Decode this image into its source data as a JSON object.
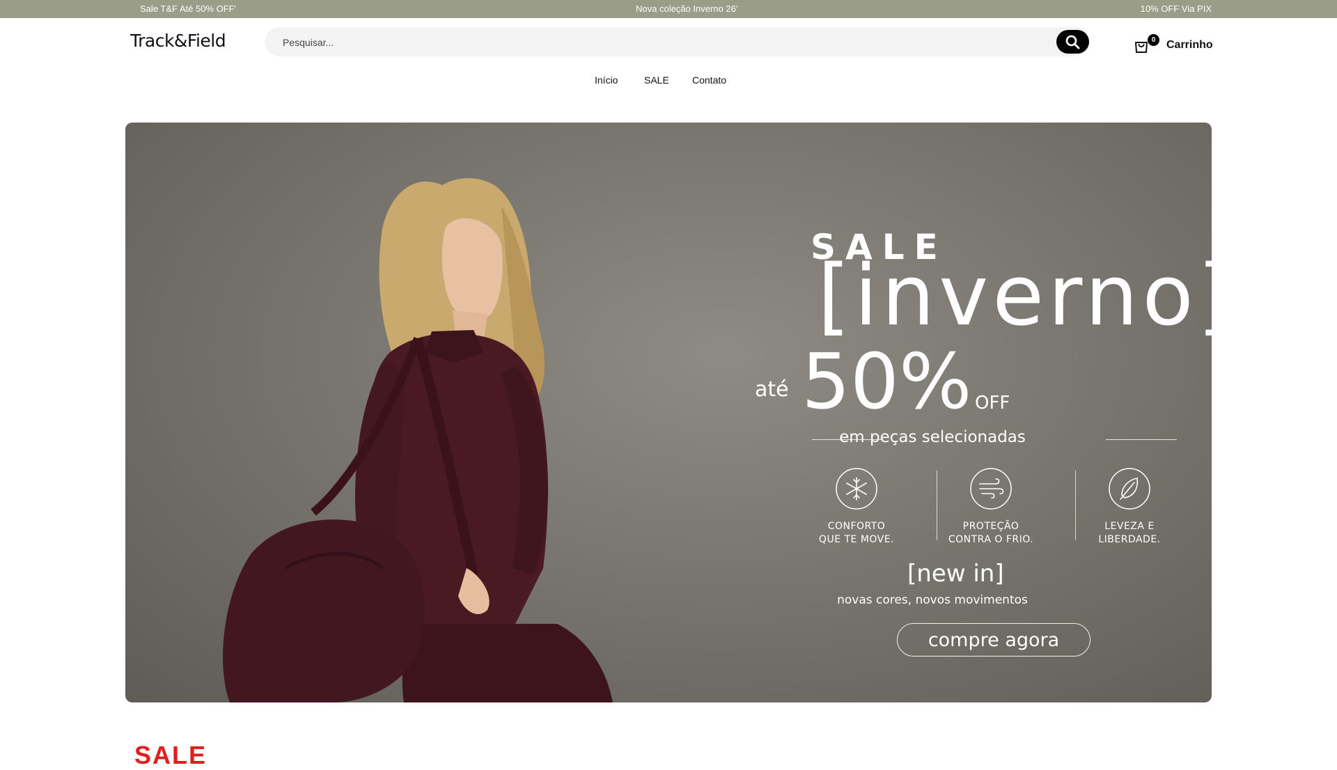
{
  "announcement": {
    "left": "Sale T&F Até 50% OFF'",
    "center": "Nova coleção Inverno 26'",
    "right": "10% OFF Via PIX"
  },
  "header": {
    "logo": "Track&Field",
    "search_placeholder": "Pesquisar...",
    "cart_count": "0",
    "cart_label": "Carrinho"
  },
  "nav": {
    "items": [
      "Início",
      "SALE",
      "Contato"
    ]
  },
  "hero": {
    "sale": "SALE",
    "inverno": "[inverno]",
    "ate": "até",
    "percent": "50%",
    "off": "OFF",
    "subtitle": "em peças selecionadas",
    "features": [
      {
        "line1": "CONFORTO",
        "line2": "QUE TE MOVE.",
        "icon": "snowflake-icon"
      },
      {
        "line1": "PROTEÇÃO",
        "line2": "CONTRA O FRIO.",
        "icon": "wind-icon"
      },
      {
        "line1": "LEVEZA E",
        "line2": "LIBERDADE.",
        "icon": "feather-icon"
      }
    ],
    "new_in": "[new in]",
    "new_in_sub": "novas cores, novos movimentos",
    "cta": "compre agora"
  },
  "section": {
    "title": "SALE"
  },
  "colors": {
    "announcement_bg": "#9a9d88",
    "hero_bg": "#78766e",
    "garment": "#4a1a22",
    "section_title": "#e11d1d"
  }
}
